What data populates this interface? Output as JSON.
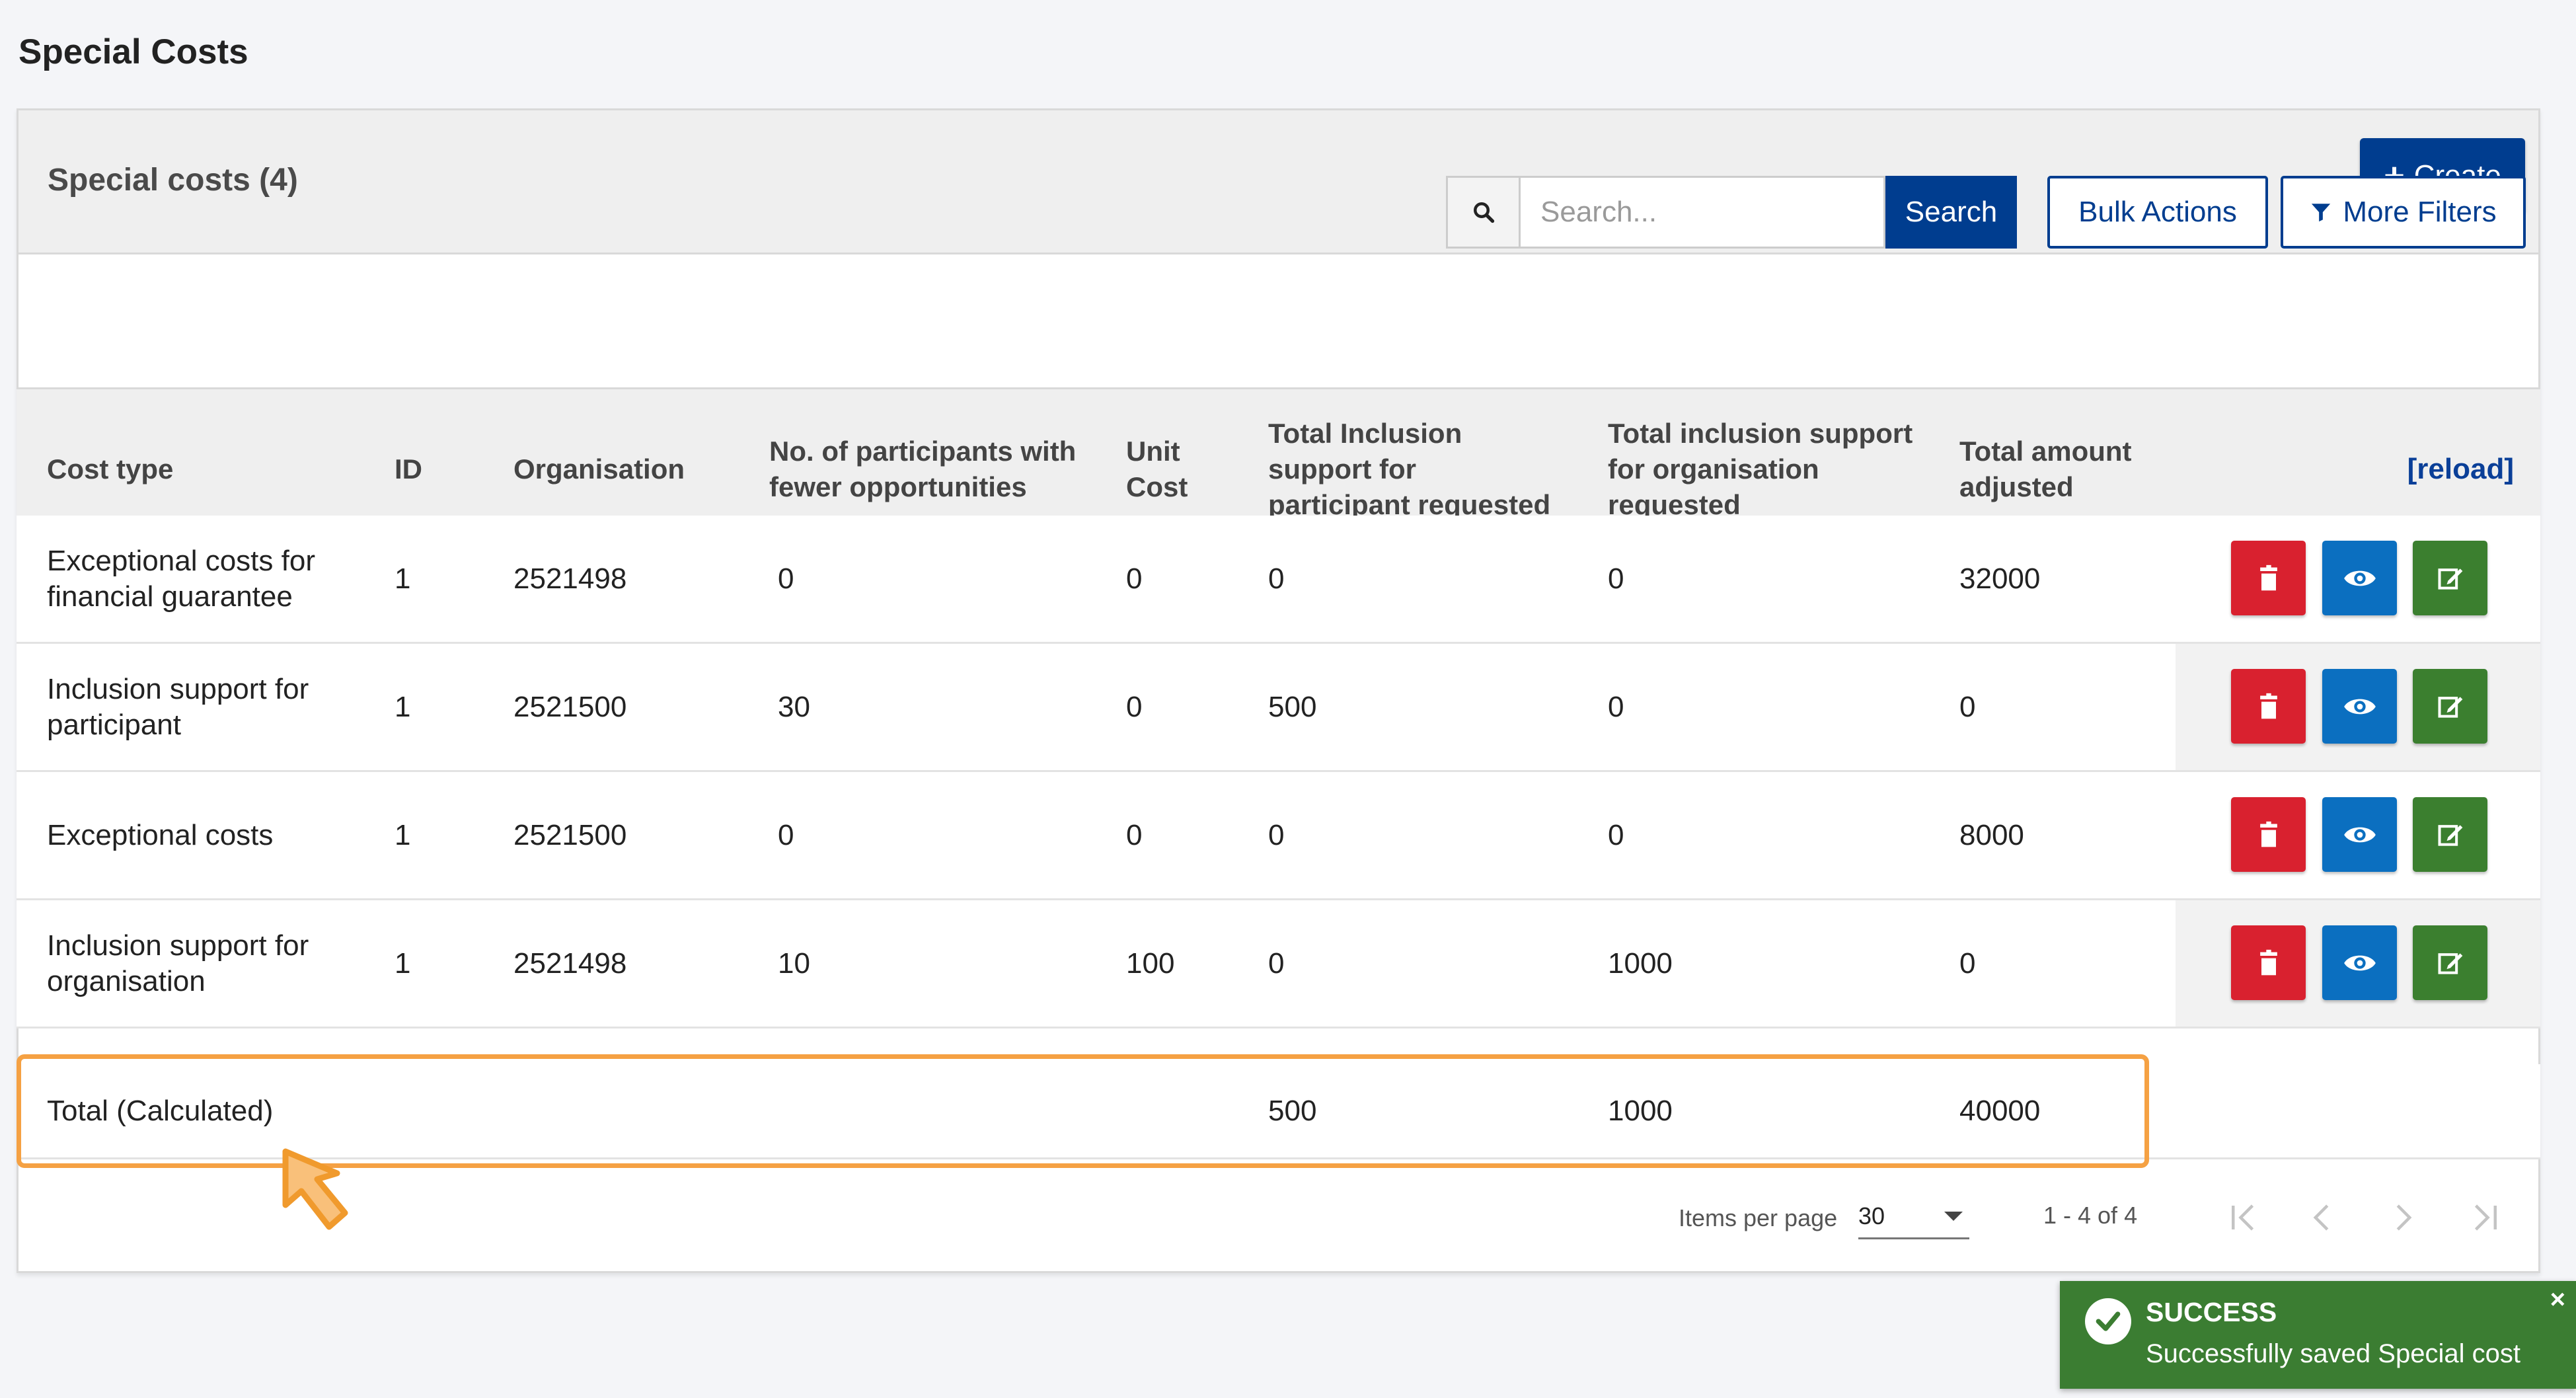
{
  "page_title": "Special Costs",
  "panel": {
    "title": "Special costs (4)",
    "create_label": "Create"
  },
  "toolbar": {
    "search_placeholder": "Search...",
    "search_label": "Search",
    "bulk_actions_label": "Bulk Actions",
    "more_filters_label": "More Filters"
  },
  "table": {
    "headers": {
      "cost_type": "Cost type",
      "id": "ID",
      "organisation": "Organisation",
      "participants_line1": "No. of participants with",
      "participants_line2": "fewer opportunities",
      "unit_cost_line1": "Unit",
      "unit_cost_line2": "Cost",
      "incl_part_line1": "Total Inclusion",
      "incl_part_line2": "support for",
      "incl_part_line3": "participant requested",
      "incl_org_line1": "Total inclusion support",
      "incl_org_line2": "for organisation",
      "incl_org_line3": "requested",
      "adjusted_line1": "Total amount",
      "adjusted_line2": "adjusted",
      "reload": "[reload]"
    },
    "rows": [
      {
        "cost_type_1": "Exceptional costs for",
        "cost_type_2": "financial guarantee",
        "id": "1",
        "organisation": "2521498",
        "participants": "0",
        "unit_cost": "0",
        "incl_part": "0",
        "incl_org": "0",
        "adjusted": "32000"
      },
      {
        "cost_type_1": "Inclusion support for",
        "cost_type_2": "participant",
        "id": "1",
        "organisation": "2521500",
        "participants": "30",
        "unit_cost": "0",
        "incl_part": "500",
        "incl_org": "0",
        "adjusted": "0"
      },
      {
        "cost_type_1": "Exceptional costs",
        "cost_type_2": "",
        "id": "1",
        "organisation": "2521500",
        "participants": "0",
        "unit_cost": "0",
        "incl_part": "0",
        "incl_org": "0",
        "adjusted": "8000"
      },
      {
        "cost_type_1": "Inclusion support for",
        "cost_type_2": "organisation",
        "id": "1",
        "organisation": "2521498",
        "participants": "10",
        "unit_cost": "100",
        "incl_part": "0",
        "incl_org": "1000",
        "adjusted": "0"
      }
    ],
    "total": {
      "label": "Total (Calculated)",
      "incl_part": "500",
      "incl_org": "1000",
      "adjusted": "40000"
    }
  },
  "pagination": {
    "items_per_page_label": "Items per page",
    "items_per_page_value": "30",
    "range": "1 - 4 of 4"
  },
  "toast": {
    "title": "SUCCESS",
    "message": "Successfully saved Special cost",
    "close": "×"
  },
  "colors": {
    "primary": "#003d8f",
    "delete": "#d9212f",
    "view": "#0b6fc0",
    "edit": "#3b7f2f",
    "highlight": "#f5a143",
    "success": "#3b7d32"
  }
}
